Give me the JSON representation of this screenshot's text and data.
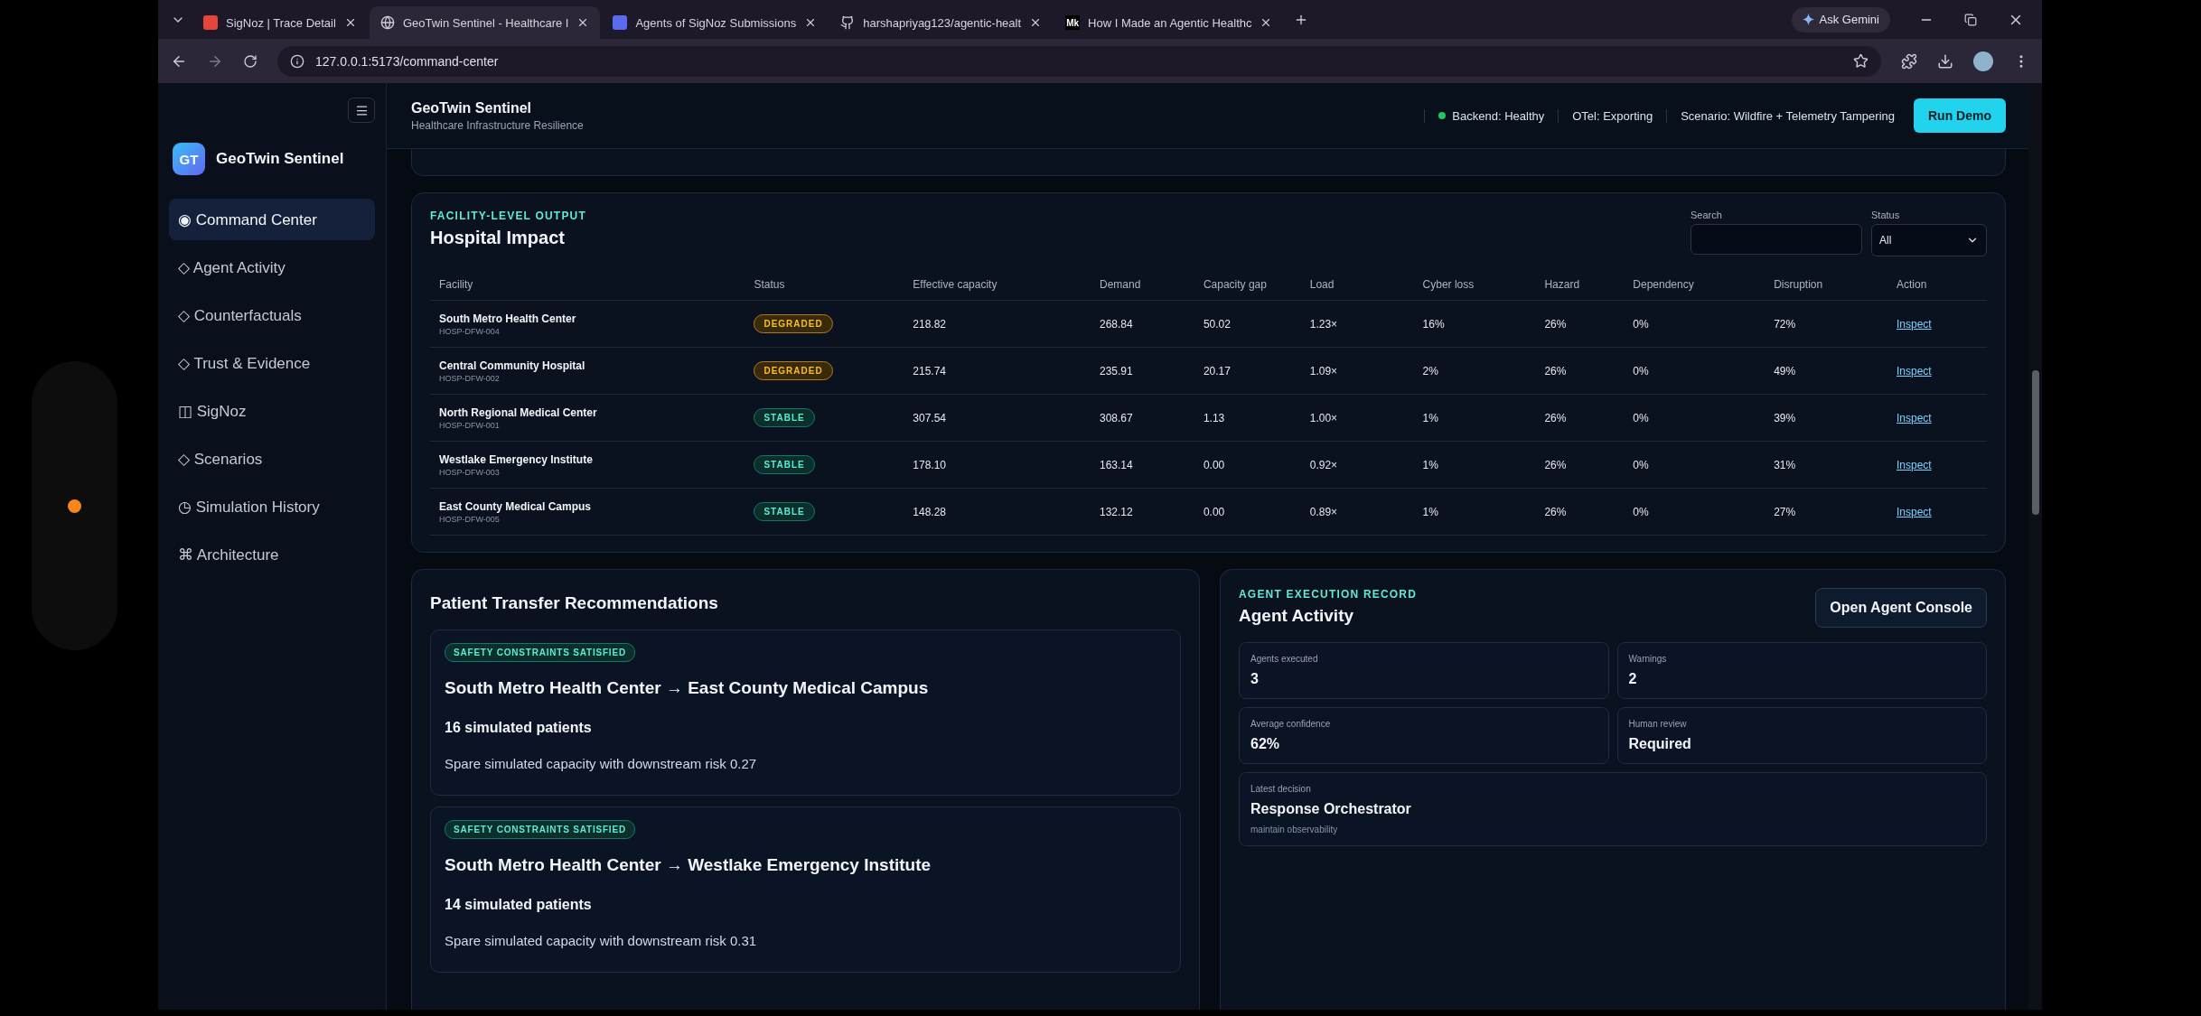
{
  "browser": {
    "tabs": [
      {
        "kind": "signoz",
        "title": "SigNoz | Trace Detail",
        "selected": false
      },
      {
        "kind": "globe",
        "title": "GeoTwin Sentinel - Healthcare I",
        "selected": true
      },
      {
        "kind": "grid",
        "title": "Agents of SigNoz Submissions",
        "selected": false
      },
      {
        "kind": "github",
        "title": "harshapriyag123/agentic-healt",
        "selected": false
      },
      {
        "kind": "text",
        "badge": "Mk",
        "title": "How I Made an Agentic Healthc",
        "selected": false
      }
    ],
    "address": "127.0.0.1:5173/command-center",
    "gemini": "Ask Gemini"
  },
  "sidebar": {
    "logo": "GT",
    "title": "GeoTwin Sentinel",
    "items": [
      {
        "icon": "◉",
        "label": "Command Center",
        "selected": true
      },
      {
        "icon": "◇",
        "label": "Agent Activity",
        "selected": false
      },
      {
        "icon": "◇",
        "label": "Counterfactuals",
        "selected": false
      },
      {
        "icon": "◇",
        "label": "Trust & Evidence",
        "selected": false
      },
      {
        "icon": "◫",
        "label": "SigNoz",
        "selected": false
      },
      {
        "icon": "◇",
        "label": "Scenarios",
        "selected": false
      },
      {
        "icon": "◷",
        "label": "Simulation History",
        "selected": false
      },
      {
        "icon": "⌘",
        "label": "Architecture",
        "selected": false
      }
    ]
  },
  "header": {
    "title": "GeoTwin Sentinel",
    "subtitle": "Healthcare Infrastructure Resilience",
    "statuses": [
      {
        "label": "Backend: Healthy",
        "color": "#22c55e"
      },
      {
        "label": "OTel: Exporting"
      },
      {
        "label": "Scenario: Wildfire + Telemetry Tampering"
      }
    ],
    "run_button": "Run Demo"
  },
  "hospital_impact": {
    "eyebrow": "FACILITY-LEVEL OUTPUT",
    "title": "Hospital Impact",
    "search": {
      "label": "Search"
    },
    "status_filter": {
      "label": "Status",
      "value": "All"
    },
    "columns": [
      "Facility",
      "Status",
      "Effective capacity",
      "Demand",
      "Capacity gap",
      "Load",
      "Cyber loss",
      "Hazard",
      "Dependency",
      "Disruption",
      "Action"
    ],
    "rows": [
      {
        "facility": "South Metro Health Center",
        "id": "HOSP-DFW-004",
        "status": "DEGRADED",
        "degraded": true,
        "effective_capacity": "218.82",
        "demand": "268.84",
        "capacity_gap": "50.02",
        "load": "1.23×",
        "cyber_loss": "16%",
        "hazard": "26%",
        "dependency": "0%",
        "disruption": "72%",
        "action": "Inspect"
      },
      {
        "facility": "Central Community Hospital",
        "id": "HOSP-DFW-002",
        "status": "DEGRADED",
        "degraded": true,
        "effective_capacity": "215.74",
        "demand": "235.91",
        "capacity_gap": "20.17",
        "load": "1.09×",
        "cyber_loss": "2%",
        "hazard": "26%",
        "dependency": "0%",
        "disruption": "49%",
        "action": "Inspect"
      },
      {
        "facility": "North Regional Medical Center",
        "id": "HOSP-DFW-001",
        "status": "STABLE",
        "degraded": false,
        "effective_capacity": "307.54",
        "demand": "308.67",
        "capacity_gap": "1.13",
        "load": "1.00×",
        "cyber_loss": "1%",
        "hazard": "26%",
        "dependency": "0%",
        "disruption": "39%",
        "action": "Inspect"
      },
      {
        "facility": "Westlake Emergency Institute",
        "id": "HOSP-DFW-003",
        "status": "STABLE",
        "degraded": false,
        "effective_capacity": "178.10",
        "demand": "163.14",
        "capacity_gap": "0.00",
        "load": "0.92×",
        "cyber_loss": "1%",
        "hazard": "26%",
        "dependency": "0%",
        "disruption": "31%",
        "action": "Inspect"
      },
      {
        "facility": "East County Medical Campus",
        "id": "HOSP-DFW-005",
        "status": "STABLE",
        "degraded": false,
        "effective_capacity": "148.28",
        "demand": "132.12",
        "capacity_gap": "0.00",
        "load": "0.89×",
        "cyber_loss": "1%",
        "hazard": "26%",
        "dependency": "0%",
        "disruption": "27%",
        "action": "Inspect"
      }
    ]
  },
  "transfers": {
    "title": "Patient Transfer Recommendations",
    "items": [
      {
        "badge": "SAFETY CONSTRAINTS SATISFIED",
        "route": "South Metro Health Center → East County Medical Campus",
        "patients": "16 simulated patients",
        "note": "Spare simulated capacity with downstream risk 0.27"
      },
      {
        "badge": "SAFETY CONSTRAINTS SATISFIED",
        "route": "South Metro Health Center → Westlake Emergency Institute",
        "patients": "14 simulated patients",
        "note": "Spare simulated capacity with downstream risk 0.31"
      }
    ]
  },
  "agent_activity": {
    "eyebrow": "AGENT EXECUTION RECORD",
    "title": "Agent Activity",
    "button": "Open Agent Console",
    "stats": [
      {
        "label": "Agents executed",
        "value": "3"
      },
      {
        "label": "Warnings",
        "value": "2"
      },
      {
        "label": "Average confidence",
        "value": "62%"
      },
      {
        "label": "Human review",
        "value": "Required"
      }
    ],
    "latest": {
      "label": "Latest decision",
      "value": "Response Orchestrator",
      "note": "maintain observability"
    }
  }
}
